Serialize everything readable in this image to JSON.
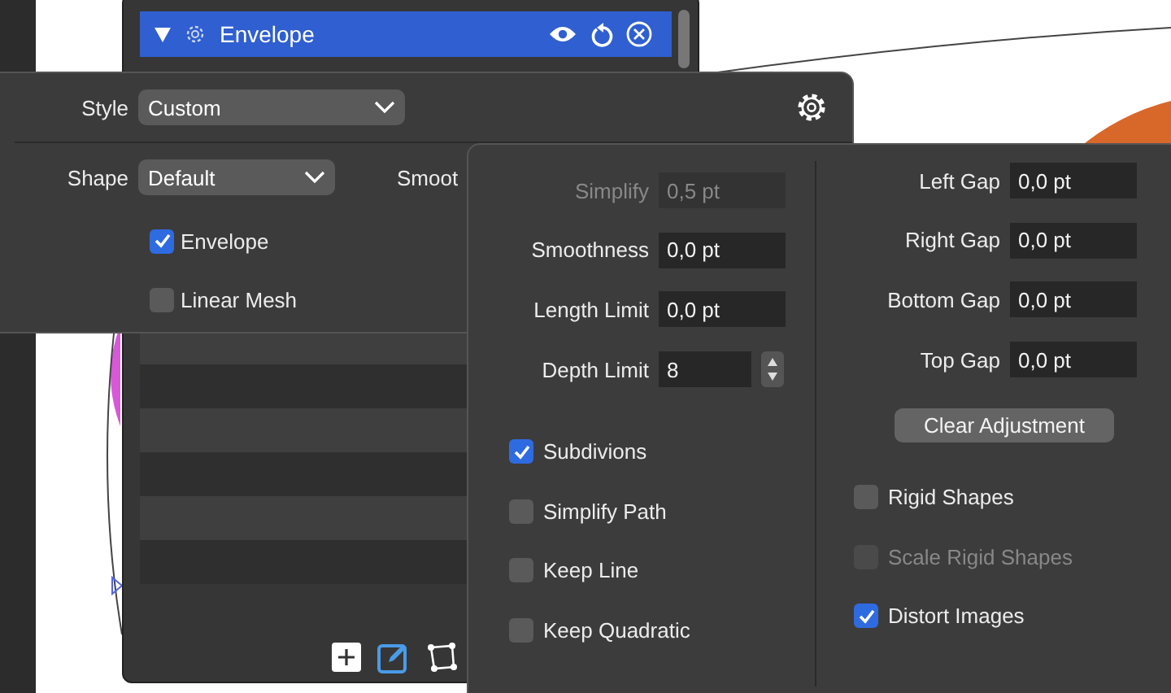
{
  "layers_panel": {
    "selected_layer": {
      "label": "Envelope",
      "expanded": true,
      "selected": true
    },
    "rows": [
      {
        "selected": false
      },
      {
        "selected": false
      },
      {
        "selected": false
      },
      {
        "selected": false
      },
      {
        "selected": false
      },
      {
        "selected": false
      }
    ]
  },
  "style_popover": {
    "style": {
      "label": "Style",
      "value": "Custom"
    },
    "shape": {
      "label": "Shape",
      "value": "Default"
    },
    "cut_label": "Smoot",
    "checkboxes": [
      {
        "label": "Envelope",
        "checked": true
      },
      {
        "label": "Linear Mesh",
        "checked": false
      }
    ]
  },
  "options_popover": {
    "fields": [
      {
        "kind": "text",
        "label": "Simplify",
        "value": "0,5 pt",
        "disabled": true
      },
      {
        "kind": "text",
        "label": "Smoothness",
        "value": "0,0 pt",
        "disabled": false
      },
      {
        "kind": "text",
        "label": "Length Limit",
        "value": "0,0 pt",
        "disabled": false
      },
      {
        "kind": "stepper",
        "label": "Depth Limit",
        "value": "8",
        "disabled": false
      }
    ],
    "options": [
      {
        "label": "Subdivions",
        "checked": true,
        "disabled": false
      },
      {
        "label": "Simplify Path",
        "checked": false,
        "disabled": false
      },
      {
        "label": "Keep Line",
        "checked": false,
        "disabled": false
      },
      {
        "label": "Keep Quadratic",
        "checked": false,
        "disabled": false
      }
    ],
    "gaps": [
      {
        "label": "Left Gap",
        "value": "0,0 pt"
      },
      {
        "label": "Right Gap",
        "value": "0,0 pt"
      },
      {
        "label": "Bottom Gap",
        "value": "0,0 pt"
      },
      {
        "label": "Top Gap",
        "value": "0,0 pt"
      }
    ],
    "clear_button": "Clear Adjustment",
    "right_options": [
      {
        "label": "Rigid Shapes",
        "checked": false,
        "disabled": false
      },
      {
        "label": "Scale Rigid Shapes",
        "checked": false,
        "disabled": true
      },
      {
        "label": "Distort Images",
        "checked": true,
        "disabled": false
      }
    ]
  }
}
